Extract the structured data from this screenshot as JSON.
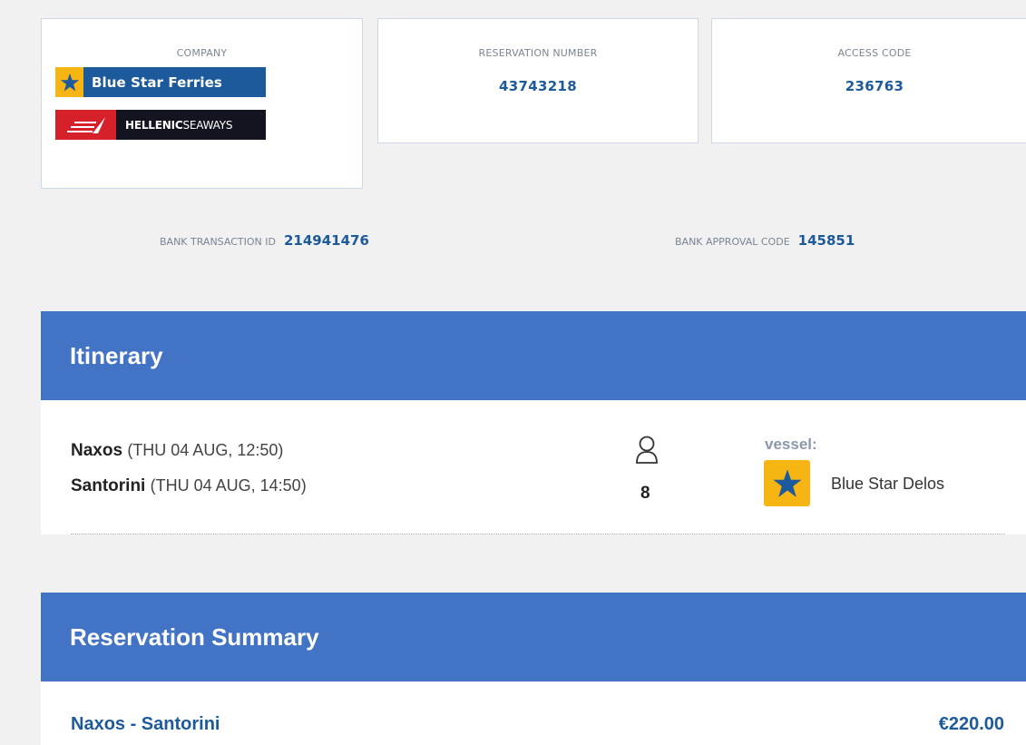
{
  "booking": {
    "company_label": "COMPANY",
    "companies": [
      "Blue Star Ferries",
      "HELLENIC SEAWAYS"
    ],
    "reservation_number_label": "RESERVATION NUMBER",
    "reservation_number": "43743218",
    "access_code_label": "ACCESS CODE",
    "access_code": "236763",
    "bank_transaction_label": "BANK TRANSACTION ID",
    "bank_transaction_id": "214941476",
    "bank_approval_label": "BANK APPROVAL CODE",
    "bank_approval_code": "145851"
  },
  "logos": {
    "blue_star": {
      "name": "Blue Star Ferries",
      "icon": "star-icon",
      "bg": "#1d5a9c",
      "accent": "#f7b514"
    },
    "hellenic": {
      "name_bold": "HELLENIC",
      "name_rest": "SEAWAYS",
      "icon": "wave-icon",
      "bg": "#141420",
      "accent": "#d6202a"
    }
  },
  "itinerary": {
    "title": "Itinerary",
    "routes": [
      {
        "port": "Naxos",
        "time": "(THU 04 AUG, 12:50)"
      },
      {
        "port": "Santorini",
        "time": "(THU 04 AUG, 14:50)"
      }
    ],
    "passenger_icon": "person-icon",
    "passengers": "8",
    "vessel_label": "vessel:",
    "vessel_name": "Blue Star Delos"
  },
  "summary": {
    "title": "Reservation Summary",
    "route": "Naxos - Santorini",
    "price": "€220.00"
  },
  "colors": {
    "header_blue": "#4373c4",
    "text_blue": "#1d5a9c",
    "accent_yellow": "#f7b514",
    "background": "#f1f1f2"
  }
}
